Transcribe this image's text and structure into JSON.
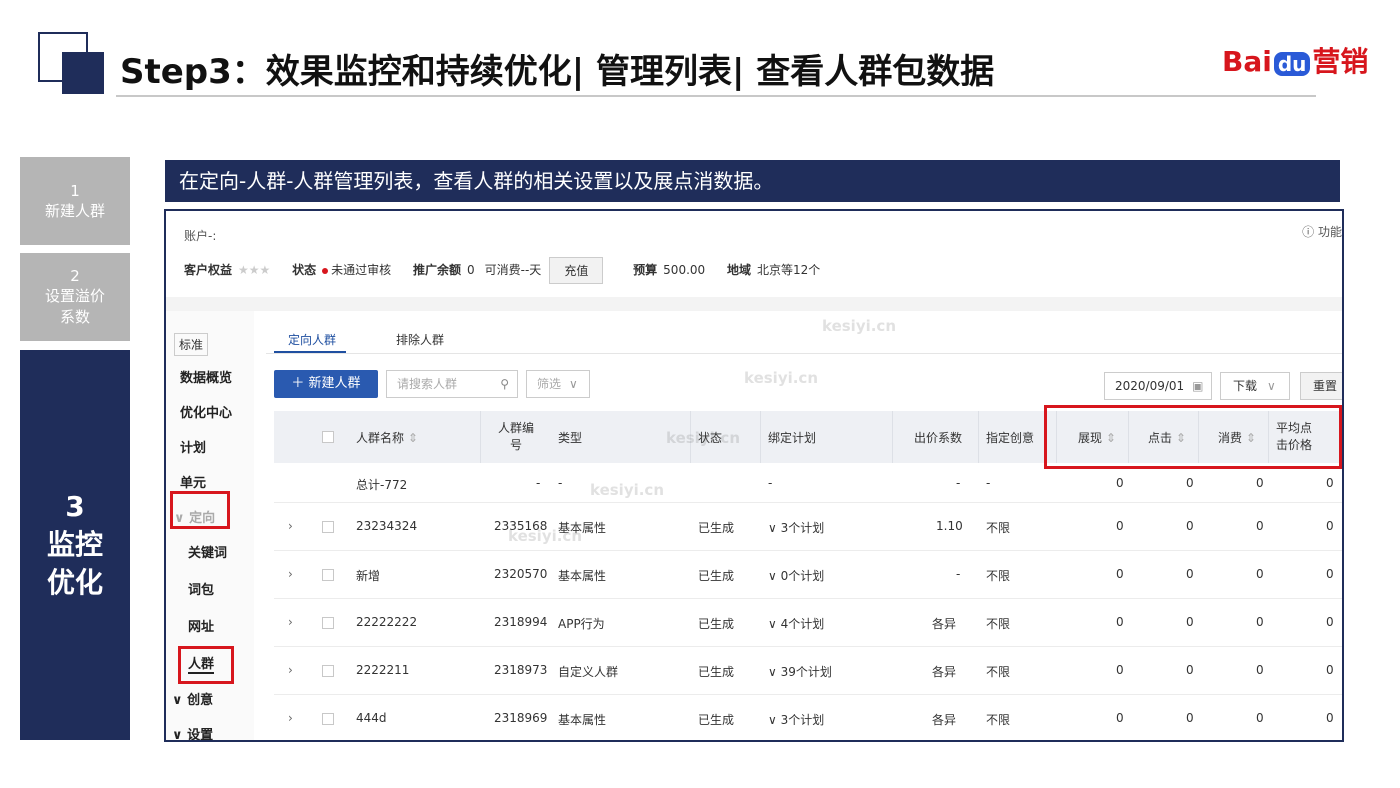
{
  "slide": {
    "title": "Step3：效果监控和持续优化| 管理列表| 查看人群包数据",
    "brand": {
      "part1": "Bai",
      "part2": "du",
      "part3": "营销"
    },
    "banner": "在定向-人群-人群管理列表，查看人群的相关设置以及展点消数据。"
  },
  "steps": [
    {
      "num": "1",
      "label": "新建人群"
    },
    {
      "num": "2",
      "label1": "设置溢价",
      "label2": "系数"
    },
    {
      "num": "3",
      "label1": "监控",
      "label2": "优化"
    }
  ],
  "account": {
    "label": "账户-:",
    "func": "ⓘ 功能",
    "rights_label": "客户权益",
    "stars": "★★★",
    "status_label": "状态",
    "status_value": "未通过审核",
    "balance_label": "推广余额",
    "balance_value": "0",
    "consumable": "可消费--天",
    "recharge": "充值",
    "budget_label": "预算",
    "budget_value": "500.00",
    "region_label": "地域",
    "region_value": "北京等12个"
  },
  "sidebar": {
    "std": "标准",
    "items": [
      "数据概览",
      "优化中心",
      "计划",
      "单元",
      "定向",
      "关键词",
      "词包",
      "网址",
      "人群",
      "创意",
      "设置"
    ]
  },
  "tabs": [
    "定向人群",
    "排除人群"
  ],
  "toolbar": {
    "new_btn": "＋ 新建人群",
    "search_placeholder": "请搜索人群",
    "filter": "筛选",
    "date": "2020/09/01",
    "download": "下载",
    "reset": "重置"
  },
  "table": {
    "headers": {
      "name": "人群名称",
      "id1": "人群编",
      "id2": "号",
      "type": "类型",
      "status": "状态",
      "plan": "绑定计划",
      "coef": "出价系数",
      "creative": "指定创意",
      "imp": "展现",
      "click": "点击",
      "cost": "消费",
      "cpc1": "平均点",
      "cpc2": "击价格"
    },
    "total": {
      "name": "总计-772",
      "id": "-",
      "type": "-",
      "plan": "-",
      "coef": "-",
      "creative": "-",
      "imp": "0",
      "click": "0",
      "cost": "0",
      "cpc": "0"
    },
    "rows": [
      {
        "name": "23234324",
        "id": "2335168",
        "type": "基本属性",
        "status": "已生成",
        "plan": "3个计划",
        "coef": "1.10",
        "creative": "不限",
        "imp": "0",
        "click": "0",
        "cost": "0",
        "cpc": "0"
      },
      {
        "name": "新增",
        "id": "2320570",
        "type": "基本属性",
        "status": "已生成",
        "plan": "0个计划",
        "coef": "-",
        "creative": "不限",
        "imp": "0",
        "click": "0",
        "cost": "0",
        "cpc": "0"
      },
      {
        "name": "22222222",
        "id": "2318994",
        "type": "APP行为",
        "status": "已生成",
        "plan": "4个计划",
        "coef": "各异",
        "creative": "不限",
        "imp": "0",
        "click": "0",
        "cost": "0",
        "cpc": "0"
      },
      {
        "name": "2222211",
        "id": "2318973",
        "type": "自定义人群",
        "status": "已生成",
        "plan": "39个计划",
        "coef": "各异",
        "creative": "不限",
        "imp": "0",
        "click": "0",
        "cost": "0",
        "cpc": "0"
      },
      {
        "name": "444d",
        "id": "2318969",
        "type": "基本属性",
        "status": "已生成",
        "plan": "3个计划",
        "coef": "各异",
        "creative": "不限",
        "imp": "0",
        "click": "0",
        "cost": "0",
        "cpc": "0"
      }
    ]
  },
  "watermark": "kesiyi.cn",
  "colors": {
    "navy": "#1f2d5a",
    "red": "#d7161d",
    "blue": "#2a5ab0"
  }
}
